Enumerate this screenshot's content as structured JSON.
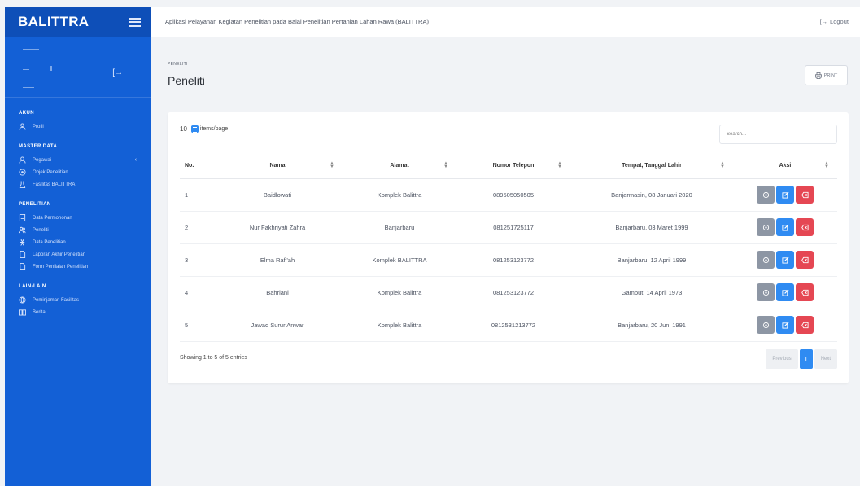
{
  "app": {
    "brand": "BALITTRA"
  },
  "topbar": {
    "title": "Aplikasi Pelayanan Kegiatan Penelitian pada Balai Penelitian Pertanian Lahan Rawa (BALITTRA)",
    "logout_label": "Logout"
  },
  "sidebar": {
    "sections": [
      {
        "title": "AKUN",
        "items": [
          {
            "label": "Profil",
            "icon": "user-icon"
          }
        ]
      },
      {
        "title": "MASTER DATA",
        "items": [
          {
            "label": "Pegawai",
            "icon": "user-icon",
            "caret": "‹"
          },
          {
            "label": "Objek Penelitian",
            "icon": "target-icon"
          },
          {
            "label": "Fasilitas BALITTRA",
            "icon": "flask-icon"
          }
        ]
      },
      {
        "title": "PENELITIAN",
        "items": [
          {
            "label": "Data Permohonan",
            "icon": "document-icon"
          },
          {
            "label": "Peneliti",
            "icon": "users-icon"
          },
          {
            "label": "Data Penelitian",
            "icon": "person-icon"
          },
          {
            "label": "Laporan Akhir Penelitian",
            "icon": "file-icon"
          },
          {
            "label": "Form Penilaian Penelitian",
            "icon": "file-icon"
          }
        ]
      },
      {
        "title": "LAIN-LAIN",
        "items": [
          {
            "label": "Peminjaman Fasilitas",
            "icon": "globe-icon"
          },
          {
            "label": "Berita",
            "icon": "book-icon"
          }
        ]
      }
    ]
  },
  "page": {
    "breadcrumb": "PENELITI",
    "title": "Peneliti",
    "print_label": "PRINT"
  },
  "table": {
    "per_page": "10",
    "per_page_label": "items/page",
    "search_placeholder": "Search...",
    "columns": [
      "No.",
      "Nama",
      "Alamat",
      "Nomor Telepon",
      "Tempat, Tanggal Lahir",
      "Aksi"
    ],
    "rows": [
      {
        "no": "1",
        "nama": "Baidlowati",
        "alamat": "Komplek Balittra",
        "telepon": "089505050505",
        "ttl": "Banjarmasin, 08 Januari 2020"
      },
      {
        "no": "2",
        "nama": "Nur Fakhriyati Zahra",
        "alamat": "Banjarbaru",
        "telepon": "081251725117",
        "ttl": "Banjarbaru, 03 Maret 1999"
      },
      {
        "no": "3",
        "nama": "Elma Rafi'ah",
        "alamat": "Komplek BALITTRA",
        "telepon": "081253123772",
        "ttl": "Banjarbaru, 12 April 1999"
      },
      {
        "no": "4",
        "nama": "Bahriani",
        "alamat": "Komplek Balittra",
        "telepon": "081253123772",
        "ttl": "Gambut, 14 April 1973"
      },
      {
        "no": "5",
        "nama": "Jawad Surur Anwar",
        "alamat": "Komplek Balittra",
        "telepon": "0812531213772",
        "ttl": "Banjarbaru, 20 Juni 1991"
      }
    ],
    "showing": "Showing 1 to 5 of 5 entries",
    "pagination": {
      "previous": "Previous",
      "current": "1",
      "next": "Next"
    }
  },
  "colors": {
    "sidebar": "#1360d6",
    "primary": "#2f8bf2",
    "danger": "#e54753",
    "secondary": "#8d96a4"
  }
}
